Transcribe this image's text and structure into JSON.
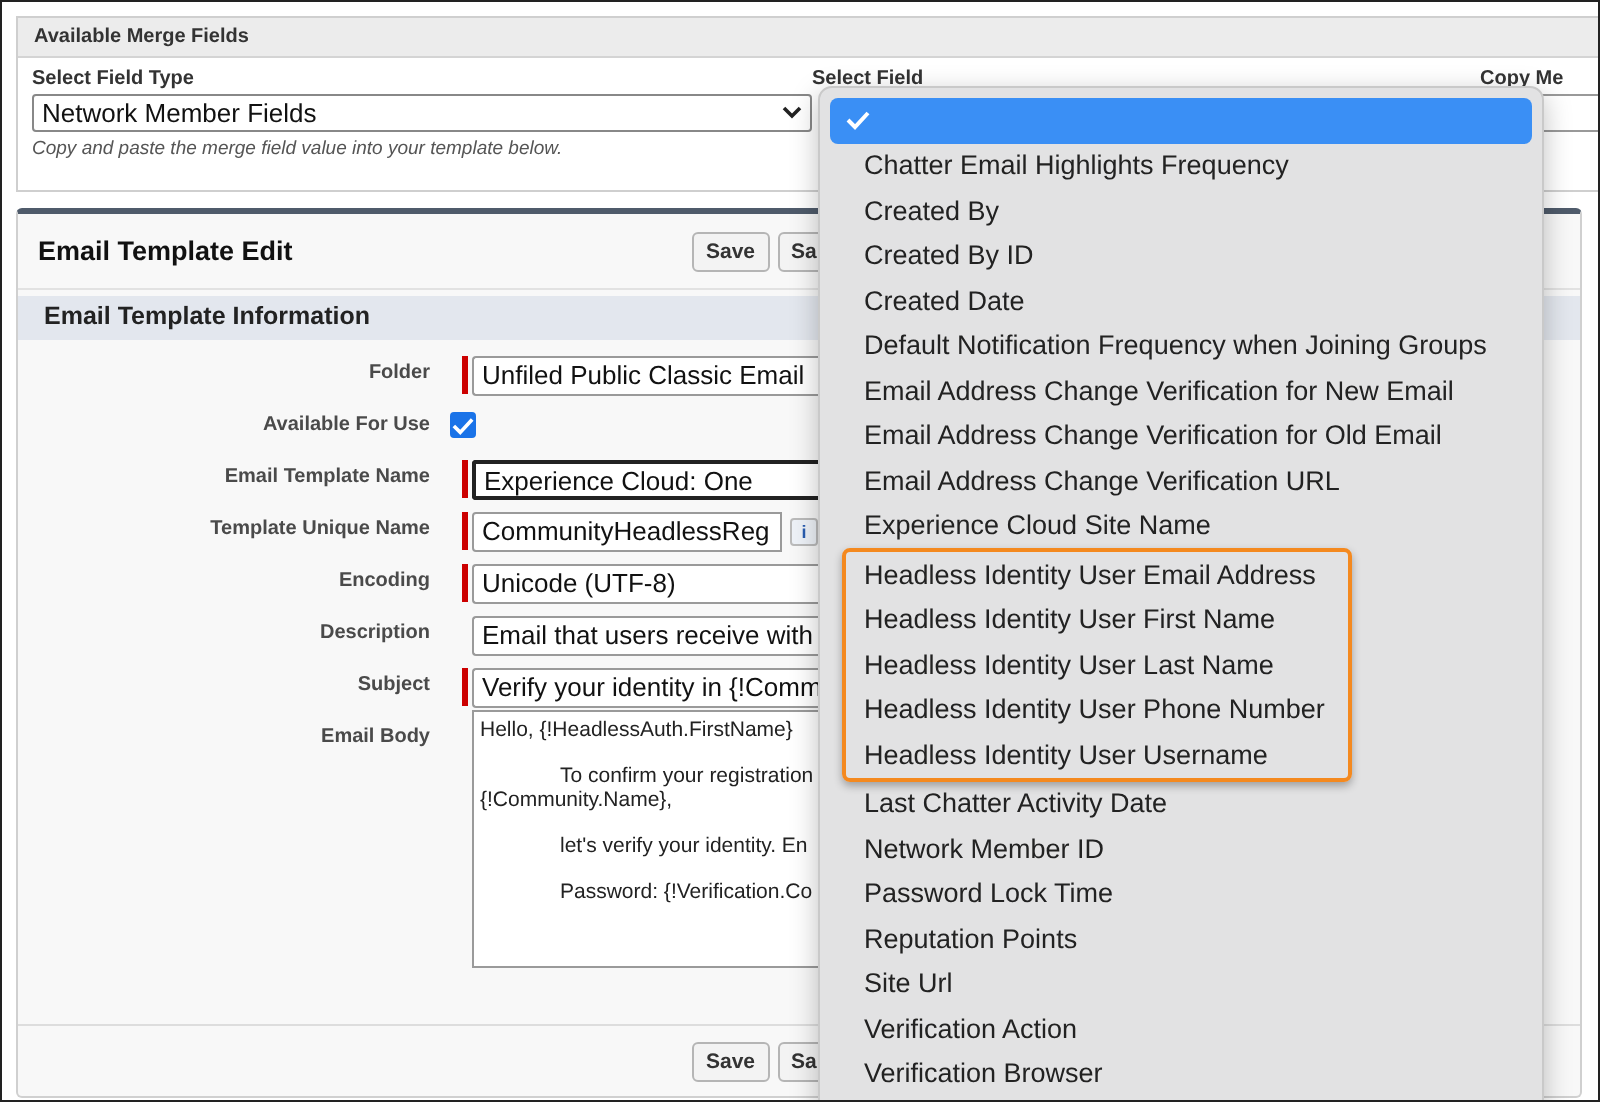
{
  "merge_fields": {
    "title": "Available Merge Fields",
    "field_type_label": "Select Field Type",
    "field_type_value": "Network Member Fields",
    "hint": "Copy and paste the merge field value into your template below.",
    "field_label": "Select Field",
    "copy_label": "Copy Me"
  },
  "editor": {
    "title": "Email Template Edit",
    "buttons": [
      "Save",
      "Sa"
    ],
    "section": "Email Template Information",
    "rows": [
      {
        "kind": "text",
        "label": "Folder",
        "value": "Unfiled Public Classic Email",
        "required": true,
        "focused": false
      },
      {
        "kind": "checkbox",
        "label": "Available For Use",
        "checked": true
      },
      {
        "kind": "text",
        "label": "Email Template Name",
        "value": "Experience Cloud: One",
        "required": true,
        "focused": true
      },
      {
        "kind": "info",
        "label": "Template Unique Name",
        "value": "CommunityHeadlessReg",
        "required": true,
        "info": "i"
      },
      {
        "kind": "text",
        "label": "Encoding",
        "value": "Unicode (UTF-8)",
        "required": true,
        "focused": false
      },
      {
        "kind": "text",
        "label": "Description",
        "value": "Email that users receive with",
        "required": false,
        "focused": false
      },
      {
        "kind": "text",
        "label": "Subject",
        "value": "Verify your identity in {!Comm",
        "required": true,
        "focused": false
      },
      {
        "kind": "body",
        "label": "Email Body",
        "lines": [
          {
            "text": "Hello, {!HeadlessAuth.FirstName}",
            "indent": false
          },
          {
            "text": "To confirm your registration",
            "indent": true
          },
          {
            "text": "{!Community.Name},",
            "indent": false
          },
          {
            "text": "let's verify your identity. En",
            "indent": true
          },
          {
            "text": "Password: {!Verification.Co",
            "indent": true
          }
        ]
      }
    ],
    "footer_buttons": [
      "Save",
      "Sa"
    ]
  },
  "dropdown": {
    "options": [
      {
        "kind": "option",
        "selected": true
      },
      {
        "kind": "option",
        "label": "Chatter Email Highlights Frequency",
        "selected": false
      },
      {
        "kind": "option",
        "label": "Created By",
        "selected": false
      },
      {
        "kind": "option",
        "label": "Created By ID",
        "selected": false
      },
      {
        "kind": "option",
        "label": "Created Date",
        "selected": false
      },
      {
        "kind": "option",
        "label": "Default Notification Frequency when Joining Groups",
        "selected": false
      },
      {
        "kind": "option",
        "label": "Email Address Change Verification for New Email",
        "selected": false
      },
      {
        "kind": "option",
        "label": "Email Address Change Verification for Old Email",
        "selected": false
      },
      {
        "kind": "option",
        "label": "Email Address Change Verification URL",
        "selected": false
      },
      {
        "kind": "option",
        "label": "Experience Cloud Site Name",
        "selected": false
      },
      {
        "kind": "highlight",
        "options": [
          {
            "label": "Headless Identity User Email Address",
            "selected": false
          },
          {
            "label": "Headless Identity User First Name",
            "selected": false
          },
          {
            "label": "Headless Identity User Last Name",
            "selected": false
          },
          {
            "label": "Headless Identity User Phone Number",
            "selected": false
          },
          {
            "label": "Headless Identity User Username",
            "selected": false
          }
        ]
      },
      {
        "kind": "option",
        "label": "Last Chatter Activity Date",
        "selected": false
      },
      {
        "kind": "option",
        "label": "Network Member ID",
        "selected": false
      },
      {
        "kind": "option",
        "label": "Password Lock Time",
        "selected": false
      },
      {
        "kind": "option",
        "label": "Reputation Points",
        "selected": false
      },
      {
        "kind": "option",
        "label": "Site Url",
        "selected": false
      },
      {
        "kind": "option",
        "label": "Verification Action",
        "selected": false
      },
      {
        "kind": "option",
        "label": "Verification Browser",
        "selected": false
      }
    ]
  }
}
